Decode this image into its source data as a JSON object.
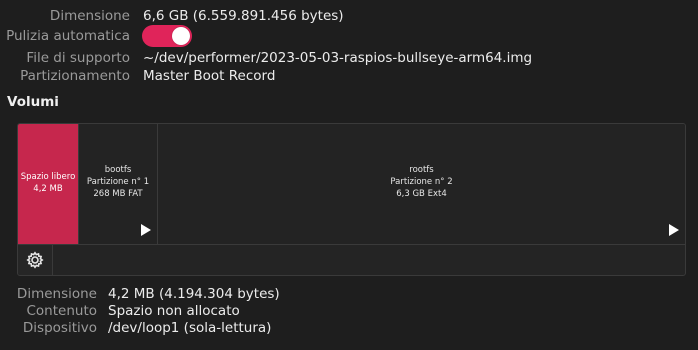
{
  "disk_info": {
    "rows": [
      {
        "label": "Dimensione",
        "value": "6,6 GB (6.559.891.456 bytes)"
      },
      {
        "label": "Pulizia automatica",
        "value": ""
      },
      {
        "label": "File di supporto",
        "value": "~/dev/performer/2023-05-03-raspios-bullseye-arm64.img"
      },
      {
        "label": "Partizionamento",
        "value": "Master Boot Record"
      }
    ],
    "auto_cleanup_enabled": true
  },
  "volumes": {
    "title": "Volumi",
    "partitions": [
      {
        "line1": "Spazio libero",
        "line2": "4,2 MB",
        "line3": ""
      },
      {
        "line1": "bootfs",
        "line2": "Partizione n° 1",
        "line3": "268 MB FAT"
      },
      {
        "line1": "rootfs",
        "line2": "Partizione n° 2",
        "line3": "6,3 GB Ext4"
      }
    ],
    "toolbar_icon": "gear-icon",
    "accent_color": "#c6274d"
  },
  "selected_volume": {
    "rows": [
      {
        "label": "Dimensione",
        "value": "4,2 MB (4.194.304 bytes)"
      },
      {
        "label": "Contenuto",
        "value": "Spazio non allocato"
      },
      {
        "label": "Dispositivo",
        "value": "/dev/loop1 (sola-lettura)"
      }
    ]
  }
}
